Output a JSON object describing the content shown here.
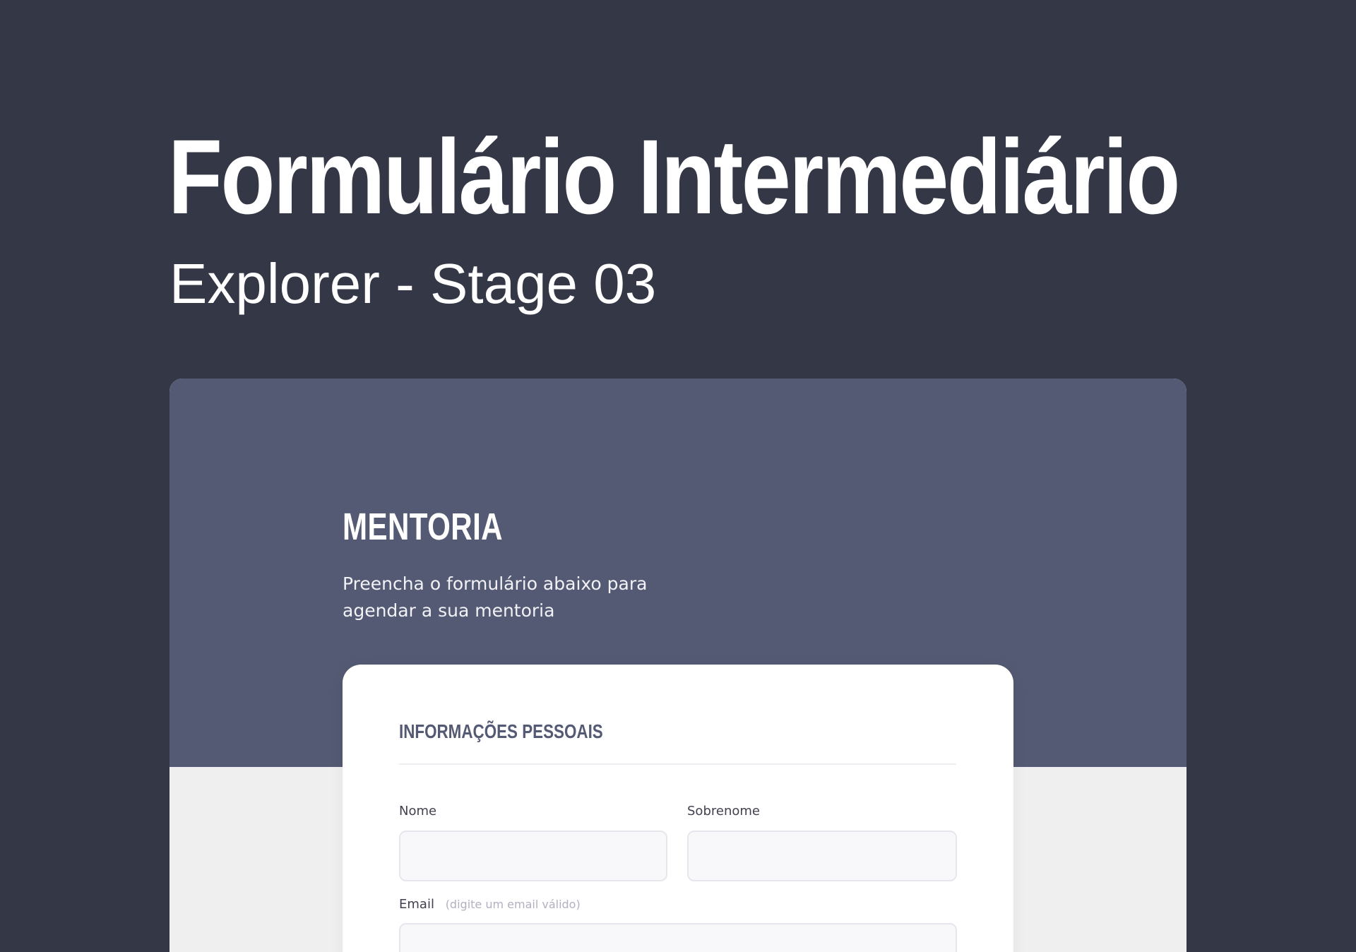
{
  "hero": {
    "title": "Formulário Intermediário",
    "subtitle": "Explorer - Stage 03"
  },
  "preview": {
    "brand": "MENTORIA",
    "description": "Preencha o formulário abaixo para agendar a sua mentoria",
    "form": {
      "section_title": "INFORMAÇÕES PESSOAIS",
      "fields": {
        "first_name": {
          "label": "Nome",
          "value": "",
          "placeholder": ""
        },
        "last_name": {
          "label": "Sobrenome",
          "value": "",
          "placeholder": ""
        },
        "email": {
          "label": "Email",
          "hint": "(digite um email válido)",
          "value": "",
          "placeholder": ""
        }
      }
    }
  },
  "colors": {
    "page_background": "#343746",
    "header_background": "#545a73",
    "content_background": "#efefef",
    "card_background": "#ffffff",
    "section_title": "#545a73"
  }
}
